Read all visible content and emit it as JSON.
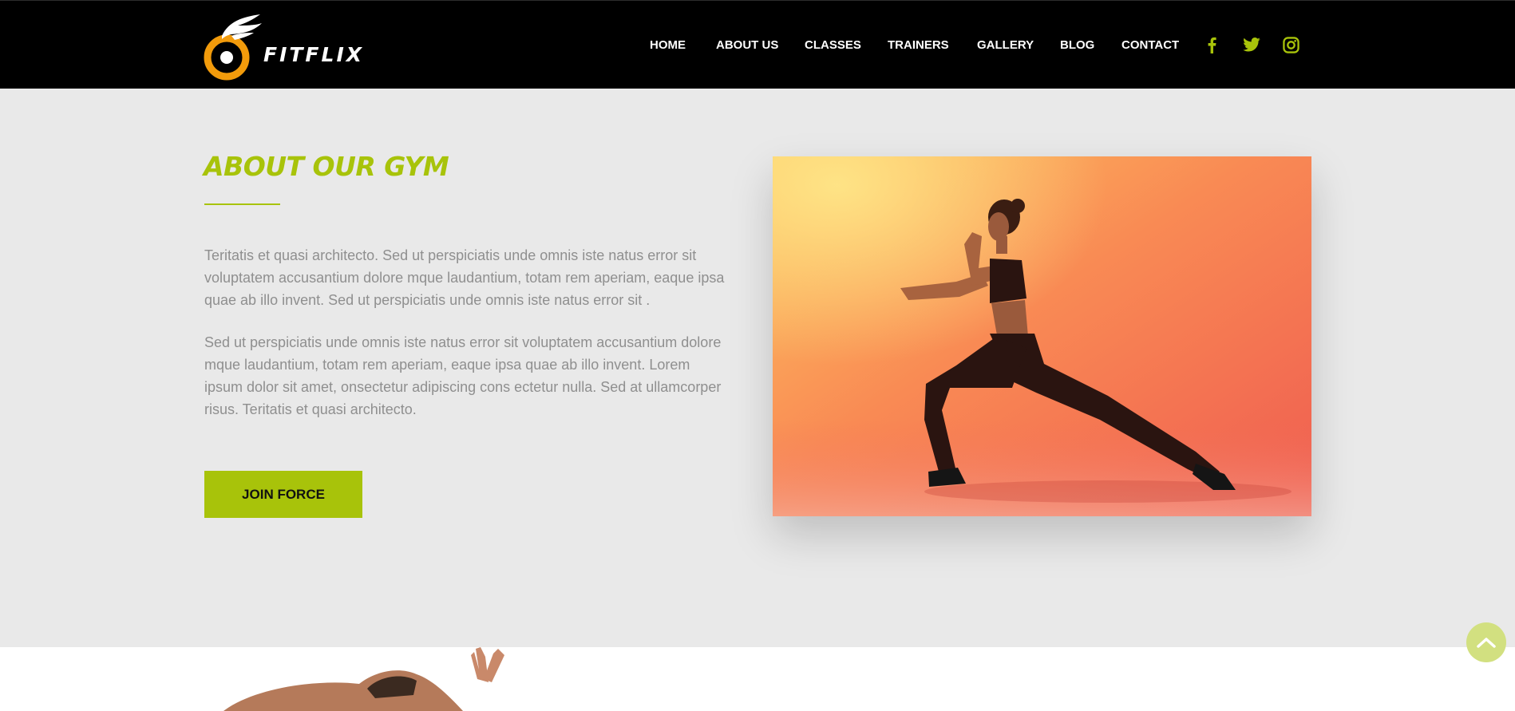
{
  "brand": {
    "name": "FITFLIX",
    "logo_icon": "runner-ring-logo",
    "colors": {
      "accent": "#a8c30a",
      "logo_orange": "#f29b0b",
      "header_bg": "#000000",
      "section_bg": "#e9e9e9"
    }
  },
  "nav": {
    "items": [
      {
        "label": "HOME"
      },
      {
        "label": "ABOUT US"
      },
      {
        "label": "CLASSES"
      },
      {
        "label": "TRAINERS"
      },
      {
        "label": "GALLERY"
      },
      {
        "label": "BLOG"
      },
      {
        "label": "CONTACT"
      }
    ],
    "social": [
      {
        "icon": "facebook-icon"
      },
      {
        "icon": "twitter-icon"
      },
      {
        "icon": "instagram-icon"
      }
    ]
  },
  "about": {
    "title": "ABOUT OUR GYM",
    "paragraphs": [
      "Teritatis et quasi architecto. Sed ut perspiciatis unde omnis iste natus error sit voluptatem accusantium dolore mque laudantium, totam rem aperiam, eaque ipsa quae ab illo invent. Sed ut perspiciatis unde omnis iste natus error sit .",
      "Sed ut perspiciatis unde omnis iste natus error sit voluptatem accusantium dolore mque laudantium, totam rem aperiam, eaque ipsa quae ab illo invent. Lorem ipsum dolor sit amet, onsectetur adipiscing cons ectetur nulla. Sed at ullamcorper risus. Teritatis et quasi architecto."
    ],
    "cta_label": "JOIN FORCE",
    "image": "woman-lunge-stretch-photo"
  },
  "scroll_top": {
    "icon": "chevron-up-icon"
  }
}
